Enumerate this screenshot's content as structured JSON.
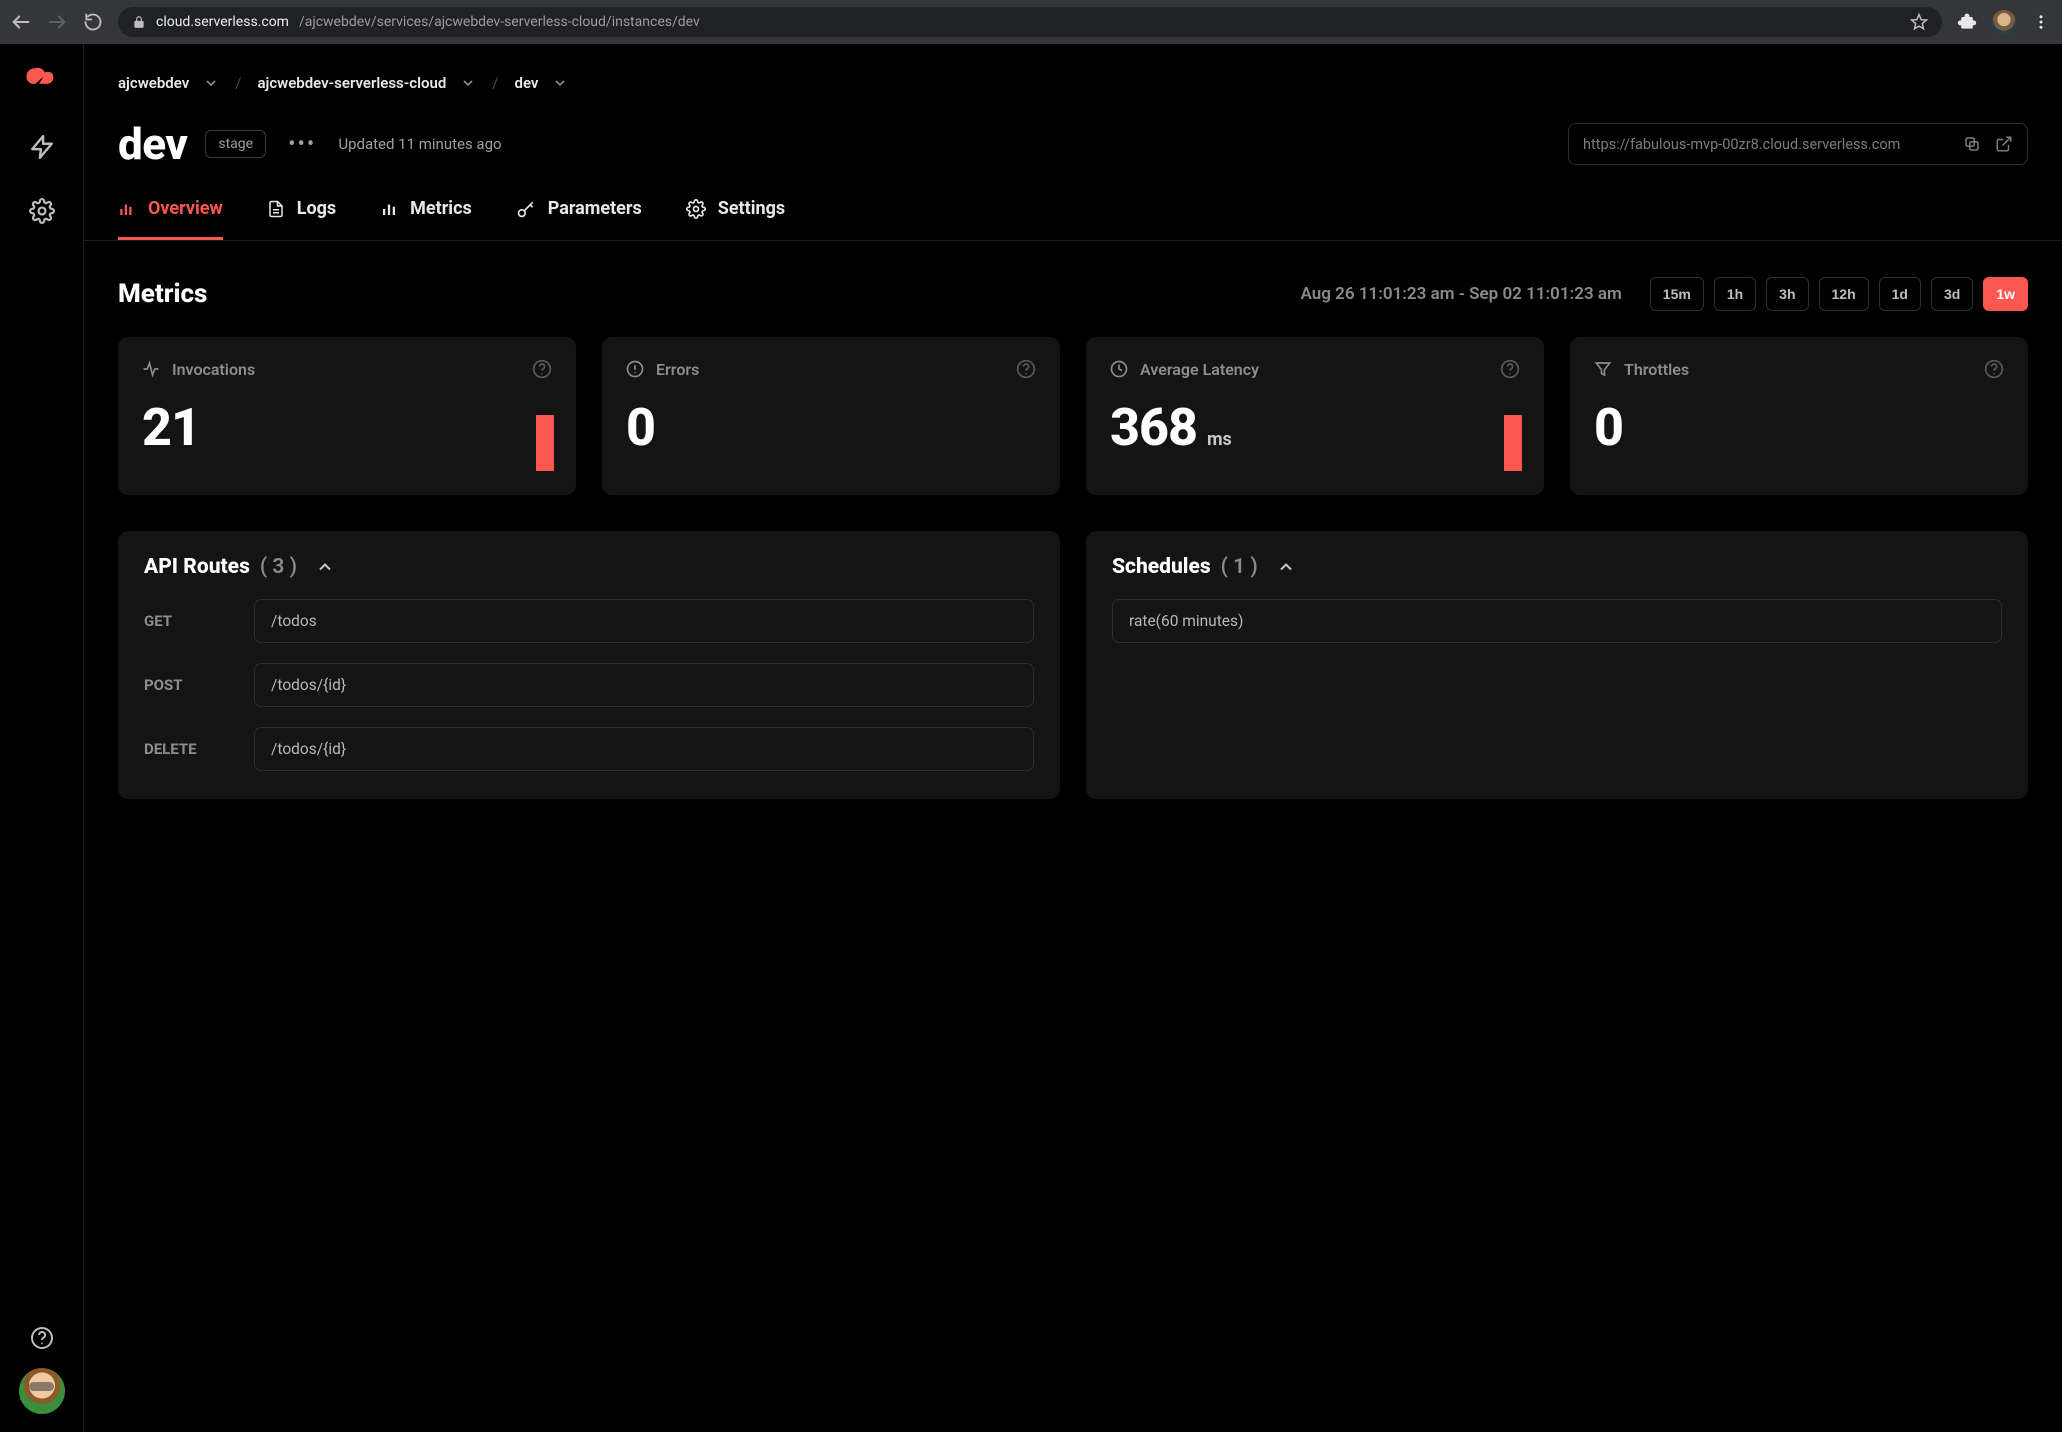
{
  "browser": {
    "url_host": "cloud.serverless.com",
    "url_path": "/ajcwebdev/services/ajcwebdev-serverless-cloud/instances/dev"
  },
  "breadcrumb": {
    "org": "ajcwebdev",
    "service": "ajcwebdev-serverless-cloud",
    "instance": "dev"
  },
  "header": {
    "title": "dev",
    "stage_label": "stage",
    "updated_text": "Updated 11 minutes ago",
    "instance_url": "https://fabulous-mvp-00zr8.cloud.serverless.com"
  },
  "tabs": {
    "overview": "Overview",
    "logs": "Logs",
    "metrics": "Metrics",
    "parameters": "Parameters",
    "settings": "Settings"
  },
  "metrics": {
    "title": "Metrics",
    "range_label": "Aug 26 11:01:23 am - Sep 02 11:01:23 am",
    "range_options": {
      "r15m": "15m",
      "r1h": "1h",
      "r3h": "3h",
      "r12h": "12h",
      "r1d": "1d",
      "r3d": "3d",
      "r1w": "1w"
    },
    "active_range": "r1w",
    "cards": {
      "invocations": {
        "label": "Invocations",
        "value": "21"
      },
      "errors": {
        "label": "Errors",
        "value": "0"
      },
      "latency": {
        "label": "Average Latency",
        "value": "368",
        "unit": "ms"
      },
      "throttles": {
        "label": "Throttles",
        "value": "0"
      }
    }
  },
  "api_routes": {
    "title": "API Routes",
    "count": "( 3 )",
    "rows": [
      {
        "method": "GET",
        "path": "/todos"
      },
      {
        "method": "POST",
        "path": "/todos/{id}"
      },
      {
        "method": "DELETE",
        "path": "/todos/{id}"
      }
    ]
  },
  "schedules": {
    "title": "Schedules",
    "count": "( 1 )",
    "rows": [
      {
        "expression": "rate(60 minutes)"
      }
    ]
  },
  "colors": {
    "accent": "#fc5750"
  }
}
